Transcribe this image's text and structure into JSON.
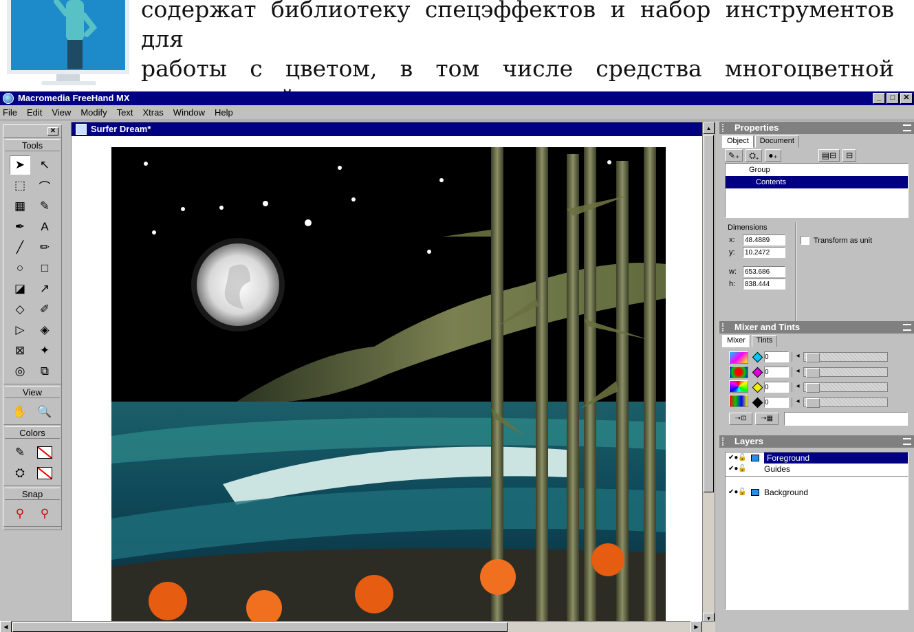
{
  "slide": {
    "lines": [
      "содержат библиотеку спецэффектов и набор инструментов для",
      "работы с цветом, в том числе средства многоцветной",
      "градиентной заливки."
    ]
  },
  "app": {
    "title": "Macromedia FreeHand MX",
    "window_buttons": [
      "_",
      "□",
      "✕"
    ]
  },
  "menu": [
    {
      "label": "File"
    },
    {
      "label": "Edit"
    },
    {
      "label": "View"
    },
    {
      "label": "Modify"
    },
    {
      "label": "Text"
    },
    {
      "label": "Xtras"
    },
    {
      "label": "Window"
    },
    {
      "label": "Help"
    }
  ],
  "toolbox": {
    "close": "✕",
    "sections": {
      "tools": "Tools",
      "view": "View",
      "colors": "Colors",
      "snap": "Snap"
    },
    "tools": [
      "➤",
      "↖",
      "⬚",
      "⌒",
      "▦",
      "✎",
      "✒",
      "A",
      "╱",
      "✏",
      "○",
      "□",
      "◪",
      "↗",
      "◇",
      "✐",
      "▷",
      "◈",
      "⊠",
      "✦",
      "◎",
      "⧉"
    ],
    "view_tools": [
      "✋",
      "🔍"
    ],
    "snap_tools": [
      "⚲",
      "⚲"
    ]
  },
  "document": {
    "title": "Surfer Dream*"
  },
  "properties": {
    "title": "Properties",
    "tabs": [
      "Object",
      "Document"
    ],
    "icon_buttons": [
      "✎₊",
      "⛭₊",
      "●₊",
      "▤⊟",
      "⊟"
    ],
    "tree": [
      "Group",
      "Contents"
    ],
    "dimensions_label": "Dimensions",
    "fields": [
      {
        "label": "x:",
        "value": "48.4889"
      },
      {
        "label": "y:",
        "value": "10.2472"
      },
      {
        "label": "w:",
        "value": "653.686"
      },
      {
        "label": "h:",
        "value": "838.444"
      }
    ],
    "transform_as_unit": "Transform as unit"
  },
  "mixer": {
    "title": "Mixer and Tints",
    "tabs": [
      "Mixer",
      "Tints"
    ],
    "channels": [
      {
        "color": "#00c8ff",
        "value": "0"
      },
      {
        "color": "#e000e0",
        "value": "0"
      },
      {
        "color": "#f0f000",
        "value": "0"
      },
      {
        "color": "#000000",
        "value": "0"
      }
    ],
    "bottom_buttons": [
      "➝⊡",
      "➝▦"
    ]
  },
  "layers": {
    "title": "Layers",
    "items": [
      {
        "name": "Foreground",
        "selected": true
      },
      {
        "name": "Guides",
        "selected": false
      },
      {
        "name": "Background",
        "selected": false
      }
    ]
  }
}
